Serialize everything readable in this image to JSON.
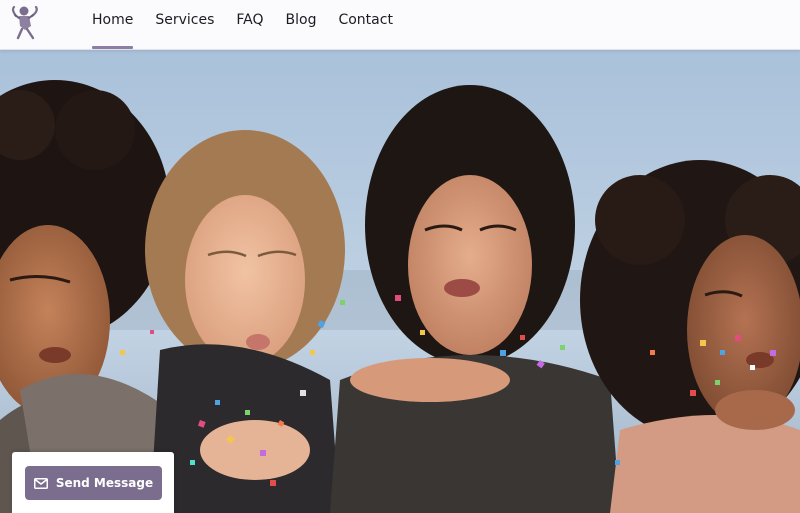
{
  "logo": {
    "icon": "dancer-logo-icon",
    "color": "#7b6d8d"
  },
  "nav": {
    "items": [
      {
        "label": "Home",
        "active": true
      },
      {
        "label": "Services",
        "active": false
      },
      {
        "label": "FAQ",
        "active": false
      },
      {
        "label": "Blog",
        "active": false
      },
      {
        "label": "Contact",
        "active": false
      }
    ],
    "active_indicator_color": "#8c7fa3"
  },
  "hero": {
    "image": "four-women-blowing-confetti-photo",
    "sky_color": "#b6cbe0"
  },
  "cta": {
    "label": "Send Message",
    "icon": "mail-icon",
    "color": "#7b6d8d"
  }
}
